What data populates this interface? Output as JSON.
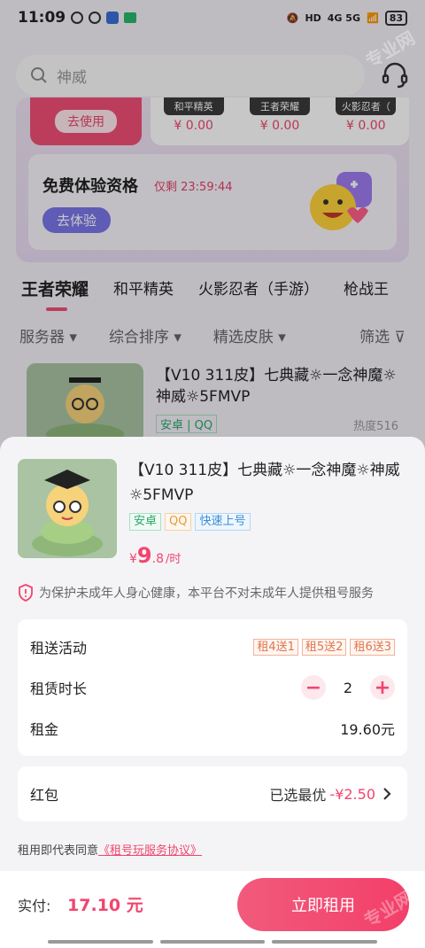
{
  "status_bar": {
    "time": "11:09",
    "network": "4G 5G",
    "battery": "83"
  },
  "search": {
    "placeholder": "神威"
  },
  "promo": {
    "coupon_button": "去使用",
    "mini_games": [
      {
        "name": "和平精英",
        "price": "¥ 0.00"
      },
      {
        "name": "王者荣耀",
        "price": "¥ 0.00"
      },
      {
        "name": "火影忍者（",
        "price": "¥ 0.00"
      }
    ],
    "trial_title": "免费体验资格",
    "trial_countdown": "仅剩 23:59:44",
    "trial_button": "去体验"
  },
  "game_tabs": [
    "王者荣耀",
    "和平精英",
    "火影忍者（手游）",
    "枪战王"
  ],
  "filters": [
    "服务器",
    "综合排序",
    "精选皮肤",
    "筛选"
  ],
  "bg_item": {
    "title": "【V10 311皮】七典藏☼一念神魔☼神威☼5FMVP",
    "tags": "安卓 | QQ",
    "heat": "热度516"
  },
  "sheet": {
    "title": "【V10 311皮】七典藏☼一念神魔☼神威☼5FMVP",
    "tags": [
      "安卓",
      "QQ",
      "快速上号"
    ],
    "price_symbol": "¥",
    "price_int": "9",
    "price_dec": ".8",
    "price_unit": "/时",
    "notice": "为保护未成年人身心健康，本平台不对未成年人提供租号服务",
    "activity_label": "租送活动",
    "activity_chips": [
      "租4送1",
      "租5送2",
      "租6送3"
    ],
    "duration_label": "租赁时长",
    "duration_value": "2",
    "minus": "−",
    "plus": "+",
    "rent_label": "租金",
    "rent_value": "19.60元",
    "redpacket_label": "红包",
    "redpacket_selected": "已选最优",
    "redpacket_amount": "-¥2.50",
    "agreement_prefix": "租用即代表同意",
    "agreement_link": "《租号玩服务协议》",
    "pay_label": "实付:",
    "pay_amount": "17.10 元",
    "pay_button": "立即租用"
  },
  "watermark": "专业网"
}
